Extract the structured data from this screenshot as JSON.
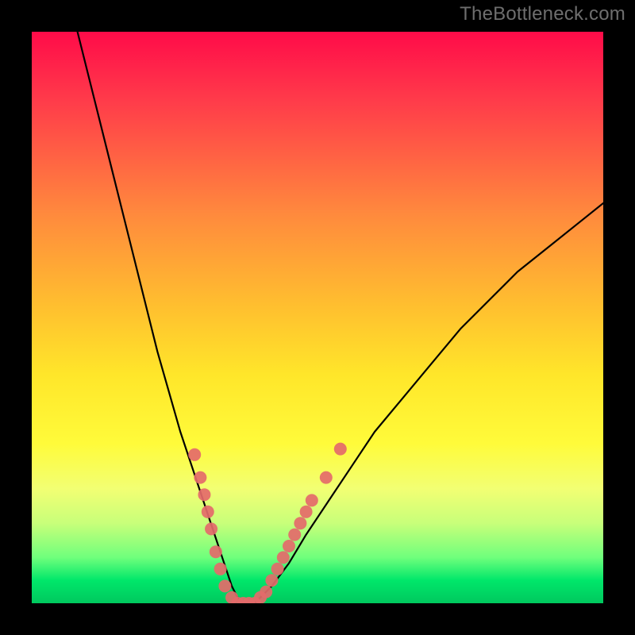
{
  "watermark": "TheBottleneck.com",
  "chart_data": {
    "type": "line",
    "title": "",
    "xlabel": "",
    "ylabel": "",
    "xlim": [
      0,
      100
    ],
    "ylim": [
      0,
      100
    ],
    "legend": false,
    "grid": false,
    "background_gradient": {
      "top_color": "#ff0b49",
      "mid_color": "#ffe62a",
      "bottom_color": "#00c85e"
    },
    "series": [
      {
        "name": "bottleneck-curve",
        "color": "#000000",
        "x": [
          8,
          10,
          12,
          14,
          16,
          18,
          20,
          22,
          24,
          26,
          28,
          30,
          32,
          33,
          34,
          35,
          36,
          37,
          38,
          39,
          40,
          42,
          45,
          48,
          52,
          56,
          60,
          65,
          70,
          75,
          80,
          85,
          90,
          95,
          100
        ],
        "values": [
          100,
          92,
          84,
          76,
          68,
          60,
          52,
          44,
          37,
          30,
          24,
          18,
          12,
          9,
          6,
          3,
          1,
          0,
          0,
          0,
          1,
          3,
          7,
          12,
          18,
          24,
          30,
          36,
          42,
          48,
          53,
          58,
          62,
          66,
          70
        ]
      }
    ],
    "points": [
      {
        "name": "marker",
        "color": "#e46a6a",
        "x": 28.5,
        "y": 26
      },
      {
        "name": "marker",
        "color": "#e46a6a",
        "x": 29.5,
        "y": 22
      },
      {
        "name": "marker",
        "color": "#e46a6a",
        "x": 30.2,
        "y": 19
      },
      {
        "name": "marker",
        "color": "#e46a6a",
        "x": 30.8,
        "y": 16
      },
      {
        "name": "marker",
        "color": "#e46a6a",
        "x": 31.4,
        "y": 13
      },
      {
        "name": "marker",
        "color": "#e46a6a",
        "x": 32.2,
        "y": 9
      },
      {
        "name": "marker",
        "color": "#e46a6a",
        "x": 33.0,
        "y": 6
      },
      {
        "name": "marker",
        "color": "#e46a6a",
        "x": 33.8,
        "y": 3
      },
      {
        "name": "marker",
        "color": "#e46a6a",
        "x": 35.0,
        "y": 1
      },
      {
        "name": "marker",
        "color": "#e46a6a",
        "x": 36.0,
        "y": 0
      },
      {
        "name": "marker",
        "color": "#e46a6a",
        "x": 37.0,
        "y": 0
      },
      {
        "name": "marker",
        "color": "#e46a6a",
        "x": 38.0,
        "y": 0
      },
      {
        "name": "marker",
        "color": "#e46a6a",
        "x": 39.0,
        "y": 0
      },
      {
        "name": "marker",
        "color": "#e46a6a",
        "x": 40.0,
        "y": 1
      },
      {
        "name": "marker",
        "color": "#e46a6a",
        "x": 41.0,
        "y": 2
      },
      {
        "name": "marker",
        "color": "#e46a6a",
        "x": 42.0,
        "y": 4
      },
      {
        "name": "marker",
        "color": "#e46a6a",
        "x": 43.0,
        "y": 6
      },
      {
        "name": "marker",
        "color": "#e46a6a",
        "x": 44.0,
        "y": 8
      },
      {
        "name": "marker",
        "color": "#e46a6a",
        "x": 45.0,
        "y": 10
      },
      {
        "name": "marker",
        "color": "#e46a6a",
        "x": 46.0,
        "y": 12
      },
      {
        "name": "marker",
        "color": "#e46a6a",
        "x": 47.0,
        "y": 14
      },
      {
        "name": "marker",
        "color": "#e46a6a",
        "x": 48.0,
        "y": 16
      },
      {
        "name": "marker",
        "color": "#e46a6a",
        "x": 49.0,
        "y": 18
      },
      {
        "name": "marker",
        "color": "#e46a6a",
        "x": 51.5,
        "y": 22
      },
      {
        "name": "marker",
        "color": "#e46a6a",
        "x": 54.0,
        "y": 27
      }
    ]
  }
}
